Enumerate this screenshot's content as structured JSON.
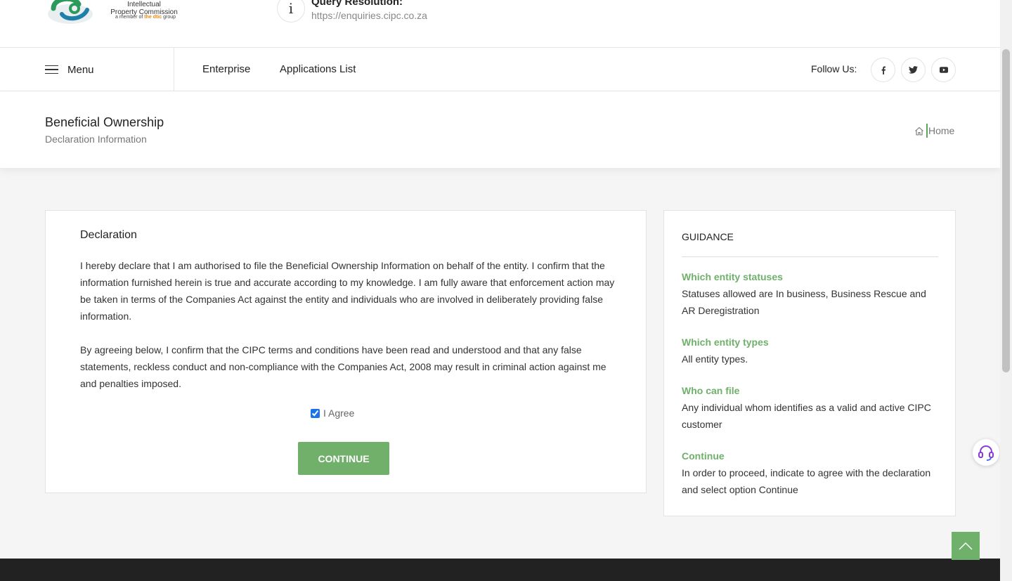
{
  "header": {
    "logo": {
      "line1": "Companies and Intellectual",
      "line2": "Property Commission",
      "member_prefix": "a member of",
      "member_the": "the",
      "member_dtic": "dtic",
      "member_suffix": "group"
    },
    "query": {
      "title": "Query Resolution:",
      "url": "https://enquiries.cipc.co.za",
      "icon": "info-icon"
    }
  },
  "nav": {
    "menu_label": "Menu",
    "links": [
      "Enterprise",
      "Applications List"
    ],
    "follow_label": "Follow Us:",
    "social": [
      "facebook-icon",
      "twitter-icon",
      "youtube-icon"
    ]
  },
  "title_band": {
    "title": "Beneficial Ownership",
    "subtitle": "Declaration Information",
    "breadcrumb_home": "Home"
  },
  "declaration": {
    "title": "Declaration",
    "paragraph1": "I hereby declare that I am authorised to file the Beneficial Ownership Information on behalf of the entity. I confirm that the information furnished herein is true and accurate according to my knowledge. I am fully aware that enforcement action may be taken in terms of the Companies Act against the entity and individuals who are involved in deliberately providing false information.",
    "paragraph2": "By agreeing below, I confirm that the CIPC terms and conditions have been read and understood and that any false statements, reckless conduct and non-compliance with the Companies Act, 2008 may result in criminal action against me and penalties imposed.",
    "agree_label": "I Agree",
    "agree_checked": true,
    "continue_label": "CONTINUE"
  },
  "guidance": {
    "title": "GUIDANCE",
    "items": [
      {
        "heading": "Which entity statuses",
        "text": "Statuses allowed are In business, Business Rescue and AR Deregistration"
      },
      {
        "heading": "Which entity types",
        "text": "All entity types."
      },
      {
        "heading": "Who can file",
        "text": "Any individual whom identifies as a valid and active CIPC customer"
      },
      {
        "heading": "Continue",
        "text": "In order to proceed, indicate to agree with the declaration and select option Continue"
      }
    ]
  },
  "colors": {
    "accent_green": "#70b06b",
    "footer": "#222222"
  }
}
